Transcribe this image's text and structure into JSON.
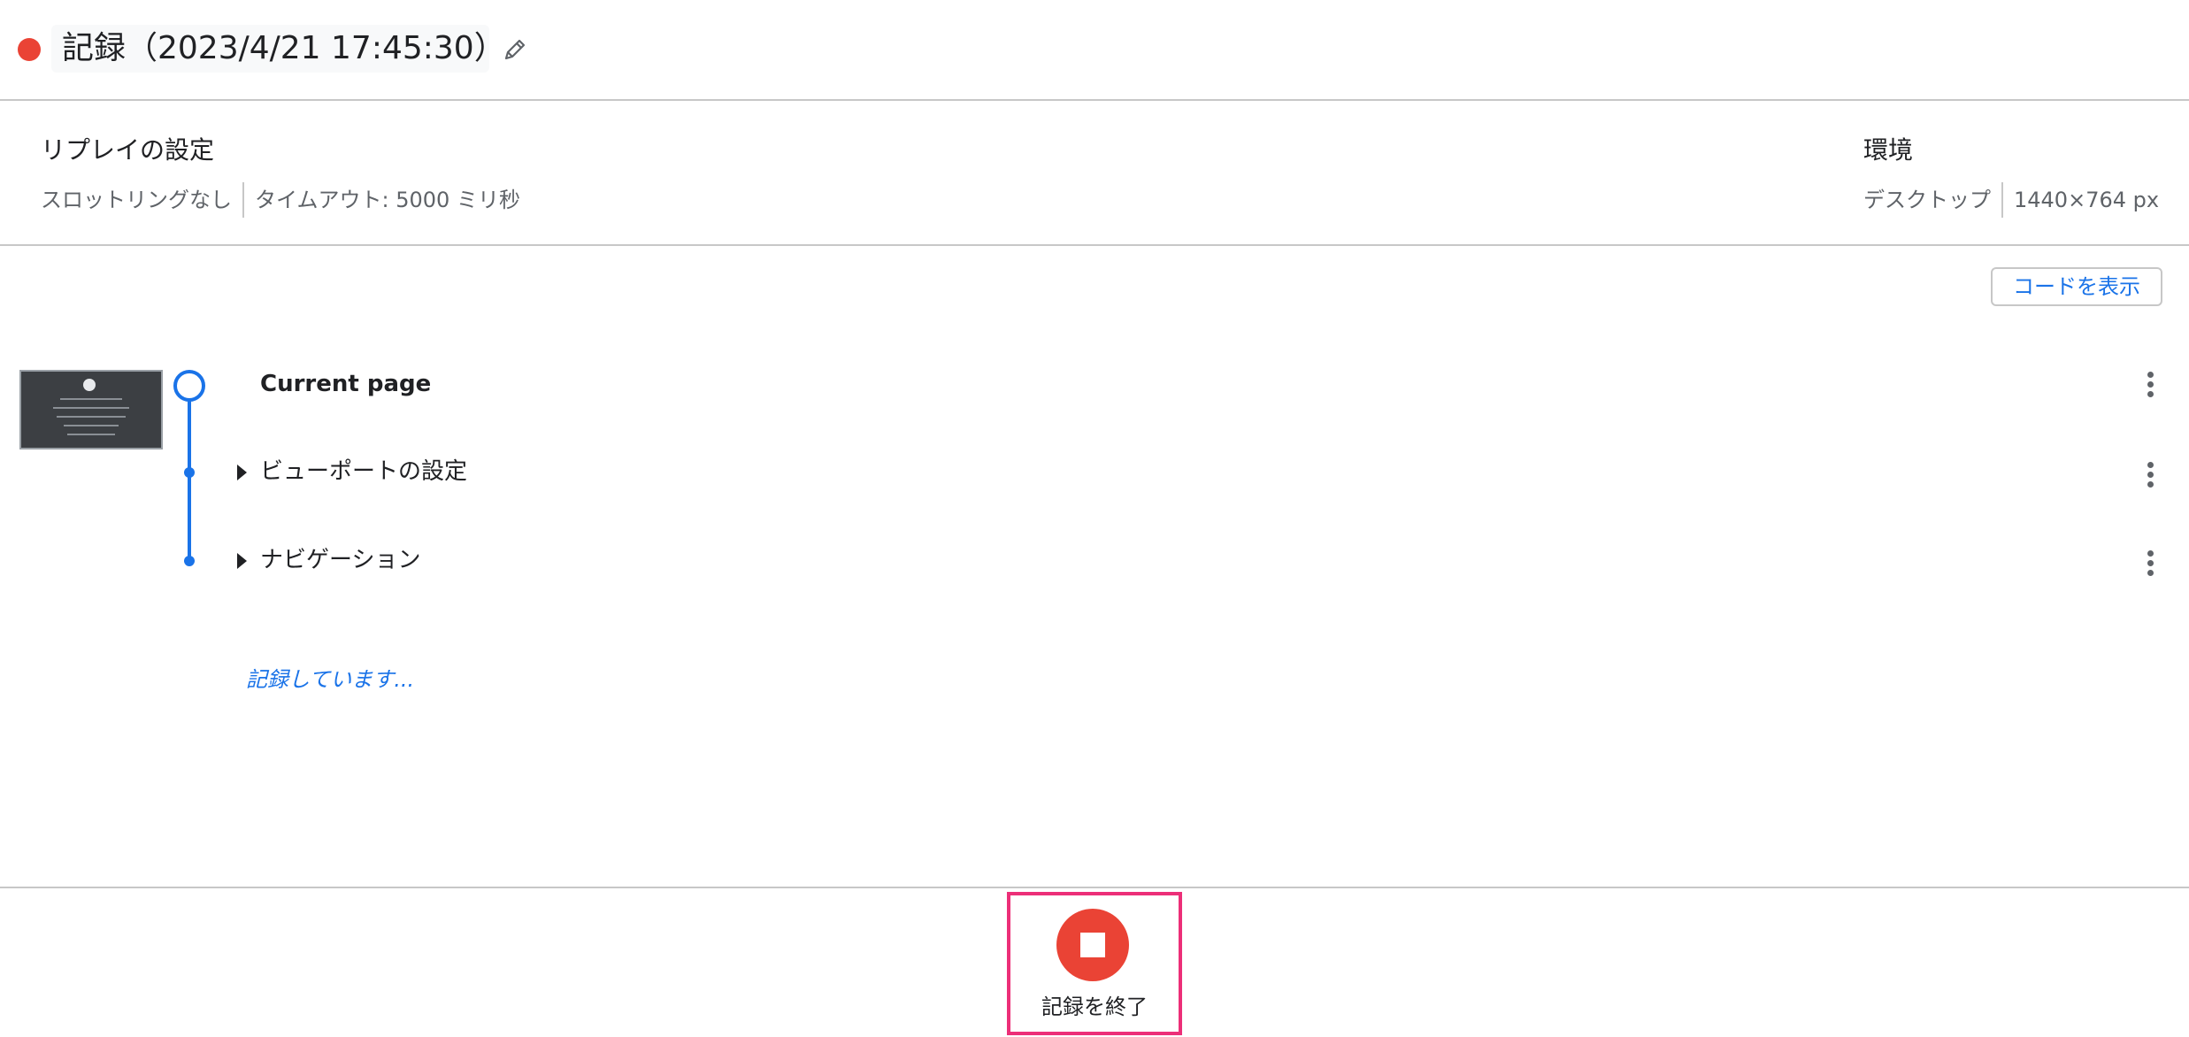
{
  "header": {
    "recording_status_color": "#ea4335",
    "title": "記録（2023/4/21 17:45:30）",
    "edit_icon": "pencil-icon"
  },
  "replay_settings": {
    "title": "リプレイの設定",
    "throttling": "スロットリングなし",
    "timeout": "タイムアウト: 5000 ミリ秒"
  },
  "environment": {
    "title": "環境",
    "device": "デスクトップ",
    "viewport": "1440×764 px"
  },
  "toolbar": {
    "show_code_label": "コードを表示"
  },
  "steps": [
    {
      "label": "Current page",
      "type": "section",
      "menu_icon": "more-vertical-icon"
    },
    {
      "label": "ビューポートの設定",
      "type": "step",
      "menu_icon": "more-vertical-icon"
    },
    {
      "label": "ナビゲーション",
      "type": "step",
      "menu_icon": "more-vertical-icon"
    }
  ],
  "status": {
    "recording_text": "記録しています..."
  },
  "footer": {
    "stop_label": "記録を終了",
    "stop_icon": "stop-icon",
    "accent_color": "#ea4335",
    "highlight_color": "#ec2f78"
  },
  "colors": {
    "link_blue": "#1a73e8",
    "divider": "#c7c7c7"
  }
}
